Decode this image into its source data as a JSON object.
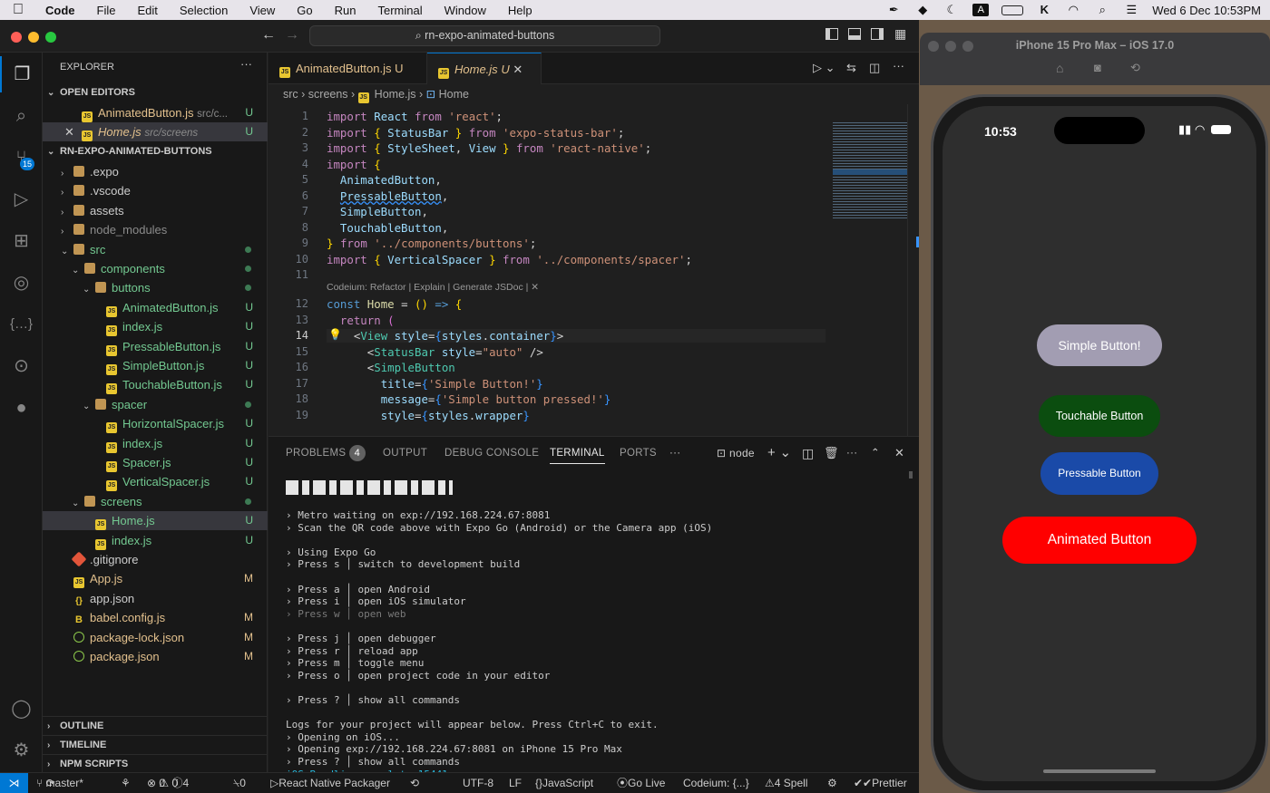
{
  "menubar": {
    "app": "Code",
    "items": [
      "File",
      "Edit",
      "Selection",
      "View",
      "Go",
      "Run",
      "Terminal",
      "Window",
      "Help"
    ],
    "input_indicator": "A",
    "datetime": "Wed 6 Dec  10:53PM"
  },
  "window": {
    "command_center": "rn-expo-animated-buttons",
    "scm_badge": "15"
  },
  "explorer": {
    "title": "EXPLORER",
    "open_editors_label": "OPEN EDITORS",
    "open_editors": [
      {
        "name": "AnimatedButton.js",
        "path": "src/c...",
        "status": "U"
      },
      {
        "name": "Home.js",
        "path": "src/screens",
        "status": "U"
      }
    ],
    "project_label": "RN-EXPO-ANIMATED-BUTTONS",
    "tree": [
      {
        "name": ".expo",
        "indent": 1,
        "kind": "folder",
        "status": ""
      },
      {
        "name": ".vscode",
        "indent": 1,
        "kind": "folder",
        "status": ""
      },
      {
        "name": "assets",
        "indent": 1,
        "kind": "folder",
        "status": ""
      },
      {
        "name": "node_modules",
        "indent": 1,
        "kind": "folder",
        "status": ""
      },
      {
        "name": "src",
        "indent": 1,
        "kind": "folder-open",
        "status": "dot"
      },
      {
        "name": "components",
        "indent": 2,
        "kind": "folder-open",
        "status": "dot"
      },
      {
        "name": "buttons",
        "indent": 3,
        "kind": "folder-open",
        "status": "dot"
      },
      {
        "name": "AnimatedButton.js",
        "indent": 4,
        "kind": "js",
        "status": "U"
      },
      {
        "name": "index.js",
        "indent": 4,
        "kind": "js",
        "status": "U"
      },
      {
        "name": "PressableButton.js",
        "indent": 4,
        "kind": "js",
        "status": "U"
      },
      {
        "name": "SimpleButton.js",
        "indent": 4,
        "kind": "js",
        "status": "U"
      },
      {
        "name": "TouchableButton.js",
        "indent": 4,
        "kind": "js",
        "status": "U"
      },
      {
        "name": "spacer",
        "indent": 3,
        "kind": "folder-open",
        "status": "dot"
      },
      {
        "name": "HorizontalSpacer.js",
        "indent": 4,
        "kind": "js",
        "status": "U"
      },
      {
        "name": "index.js",
        "indent": 4,
        "kind": "js",
        "status": "U"
      },
      {
        "name": "Spacer.js",
        "indent": 4,
        "kind": "js",
        "status": "U"
      },
      {
        "name": "VerticalSpacer.js",
        "indent": 4,
        "kind": "js",
        "status": "U"
      },
      {
        "name": "screens",
        "indent": 2,
        "kind": "folder-open",
        "status": "dot"
      },
      {
        "name": "Home.js",
        "indent": 3,
        "kind": "js",
        "status": "U"
      },
      {
        "name": "index.js",
        "indent": 3,
        "kind": "js",
        "status": "U"
      },
      {
        "name": ".gitignore",
        "indent": 1,
        "kind": "git",
        "status": ""
      },
      {
        "name": "App.js",
        "indent": 1,
        "kind": "js",
        "status": "M"
      },
      {
        "name": "app.json",
        "indent": 1,
        "kind": "json",
        "status": ""
      },
      {
        "name": "babel.config.js",
        "indent": 1,
        "kind": "babel",
        "status": "M"
      },
      {
        "name": "package-lock.json",
        "indent": 1,
        "kind": "npm",
        "status": "M"
      },
      {
        "name": "package.json",
        "indent": 1,
        "kind": "npm",
        "status": "M"
      }
    ],
    "outline_label": "OUTLINE",
    "timeline_label": "TIMELINE",
    "npm_label": "NPM SCRIPTS"
  },
  "tabs": [
    {
      "name": "AnimatedButton.js",
      "status": "U"
    },
    {
      "name": "Home.js",
      "status": "U"
    }
  ],
  "breadcrumb": [
    "src",
    "screens",
    "Home.js",
    "Home"
  ],
  "codelens": "Codeium: Refactor | Explain | Generate JSDoc | ✕",
  "line_numbers": [
    "1",
    "2",
    "3",
    "4",
    "5",
    "6",
    "7",
    "8",
    "9",
    "10",
    "11",
    "12",
    "13",
    "14",
    "15",
    "16",
    "17",
    "18",
    "19"
  ],
  "panel": {
    "tabs": [
      "PROBLEMS",
      "OUTPUT",
      "DEBUG CONSOLE",
      "TERMINAL",
      "PORTS"
    ],
    "problems_count": "4",
    "shell": "node"
  },
  "terminal": [
    "› Metro waiting on exp://192.168.224.67:8081",
    "› Scan the QR code above with Expo Go (Android) or the Camera app (iOS)",
    "",
    "› Using Expo Go",
    "› Press s │ switch to development build",
    "",
    "› Press a │ open Android",
    "› Press i │ open iOS simulator",
    "› Press w │ open web",
    "",
    "› Press j │ open debugger",
    "› Press r │ reload app",
    "› Press m │ toggle menu",
    "› Press o │ open project code in your editor",
    "",
    "› Press ? │ show all commands",
    "",
    "Logs for your project will appear below. Press Ctrl+C to exit.",
    "› Opening on iOS...",
    "› Opening exp://192.168.224.67:8081 on iPhone 15 Pro Max",
    "› Press ? │ show all commands",
    "iOS Bundling complete 15441ms"
  ],
  "statusbar": {
    "branch": "master*",
    "errors": "0",
    "warnings": "0",
    "info": "4",
    "ports": "0",
    "packager": "React Native Packager",
    "encoding": "UTF-8",
    "eol": "LF",
    "language": "JavaScript",
    "golive": "Go Live",
    "codeium": "Codeium: {...}",
    "spell": "4 Spell",
    "prettier": "Prettier"
  },
  "simulator": {
    "title": "iPhone 15 Pro Max – iOS 17.0",
    "time": "10:53"
  },
  "app_buttons": {
    "simple": "Simple Button!",
    "touchable": "Touchable Button",
    "pressable": "Pressable Button",
    "animated": "Animated Button"
  },
  "colors": {
    "simple": "#a29db2",
    "touchable": "#0b4d0f",
    "pressable": "#1a4aa8",
    "animated": "#ff0000"
  }
}
